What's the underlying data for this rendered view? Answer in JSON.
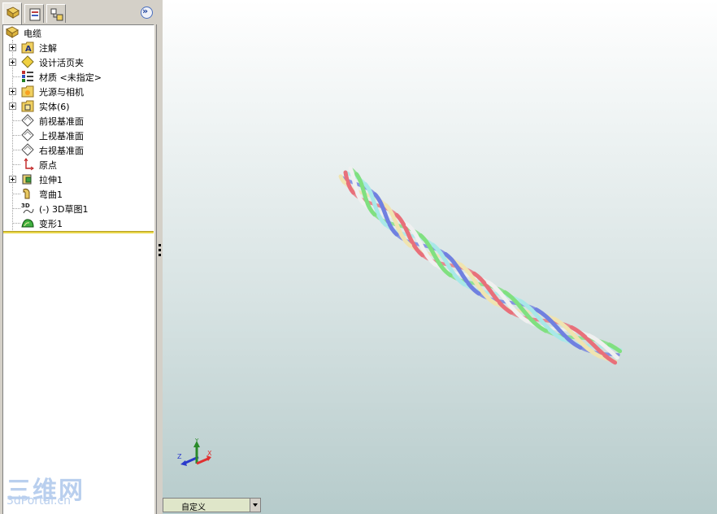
{
  "feature_tree": {
    "root_label": "电缆",
    "items": [
      {
        "label": "注解",
        "icon": "annotations-icon",
        "expandable": true
      },
      {
        "label": "设计活页夹",
        "icon": "design-binder-icon",
        "expandable": true
      },
      {
        "label": "材质 <未指定>",
        "icon": "material-icon",
        "expandable": false
      },
      {
        "label": "光源与相机",
        "icon": "lights-cameras-icon",
        "expandable": true
      },
      {
        "label": "实体(6)",
        "icon": "solid-bodies-icon",
        "expandable": true
      },
      {
        "label": "前视基准面",
        "icon": "plane-icon",
        "expandable": false
      },
      {
        "label": "上视基准面",
        "icon": "plane-icon",
        "expandable": false
      },
      {
        "label": "右视基准面",
        "icon": "plane-icon",
        "expandable": false
      },
      {
        "label": "原点",
        "icon": "origin-icon",
        "expandable": false
      },
      {
        "label": "拉伸1",
        "icon": "extrude-icon",
        "expandable": true
      },
      {
        "label": "弯曲1",
        "icon": "flex-icon",
        "expandable": false
      },
      {
        "label": "(-) 3D草图1",
        "icon": "3d-sketch-icon",
        "expandable": false
      },
      {
        "label": "变形1",
        "icon": "deform-icon",
        "expandable": false
      }
    ]
  },
  "tabs": [
    {
      "name": "feature-manager-tab",
      "icon": "feature-manager-icon"
    },
    {
      "name": "property-manager-tab",
      "icon": "property-manager-icon"
    },
    {
      "name": "configuration-manager-tab",
      "icon": "configuration-manager-icon"
    }
  ],
  "expand_button": {
    "icon": "chevron-double-right-icon",
    "label": "»"
  },
  "configuration": {
    "selected": "自定义"
  },
  "triad": {
    "x_label": "X",
    "y_label": "Y",
    "z_label": "Z",
    "x_color": "#e03030",
    "y_color": "#2a8a2a",
    "z_color": "#2a3acc"
  },
  "watermark": {
    "line1": "三维网",
    "line2": "3dPortal.cn"
  },
  "cable": {
    "strand_colors": [
      "#e8707a",
      "#f0e4b0",
      "#7080e0",
      "#a8e8e8",
      "#80e080",
      "#f0f0f0"
    ]
  },
  "colors": {
    "rollback_bar": "#e8d64a",
    "panel_bg": "#d4d0c8"
  }
}
